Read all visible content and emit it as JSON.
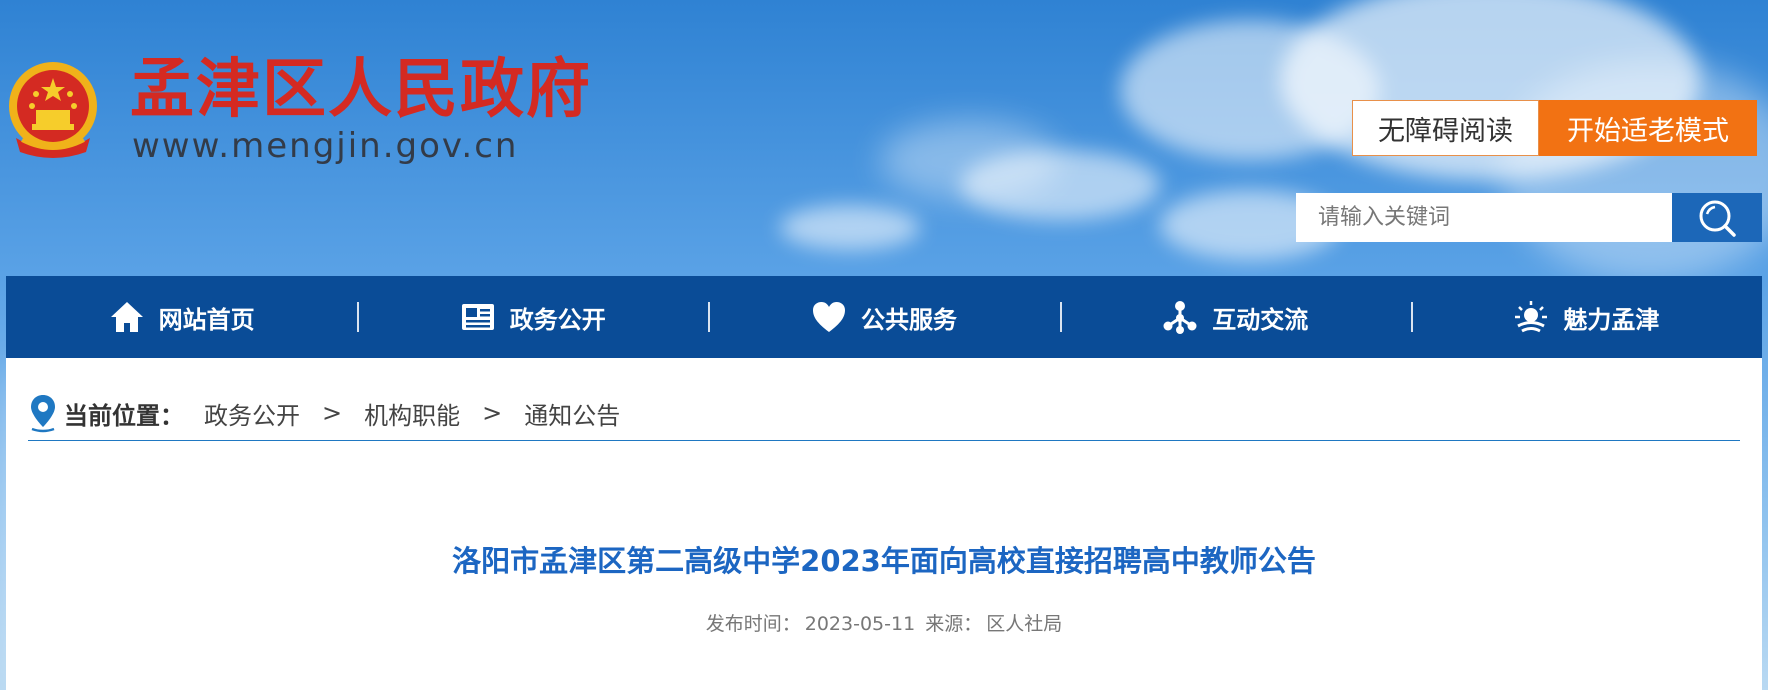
{
  "header": {
    "site_title": "孟津区人民政府",
    "site_url": "www.mengjin.gov.cn",
    "accessibility_button": "无障碍阅读",
    "elder_mode_button": "开始适老模式",
    "search": {
      "placeholder": "请输入关键词",
      "button_icon": "search-icon"
    },
    "emblem_icon": "national-emblem-icon"
  },
  "nav": {
    "items": [
      {
        "label": "网站首页",
        "icon": "home-icon"
      },
      {
        "label": "政务公开",
        "icon": "newspaper-icon"
      },
      {
        "label": "公共服务",
        "icon": "heart-icon"
      },
      {
        "label": "互动交流",
        "icon": "network-icon"
      },
      {
        "label": "魅力孟津",
        "icon": "sun-icon"
      }
    ]
  },
  "breadcrumb": {
    "label": "当前位置：",
    "items": [
      "政务公开",
      "机构职能",
      "通知公告"
    ],
    "separator": ">",
    "icon": "location-pin-icon"
  },
  "article": {
    "title": "洛阳市孟津区第二高级中学2023年面向高校直接招聘高中教师公告",
    "publish_label": "发布时间：",
    "publish_date": "2023-05-11",
    "source_label": "来源：",
    "source": "区人社局"
  },
  "colors": {
    "title_red": "#d42a22",
    "nav_blue": "#0a4c97",
    "accent_orange": "#f27213",
    "search_blue": "#1c67b8",
    "article_title_blue": "#1c66c2"
  }
}
